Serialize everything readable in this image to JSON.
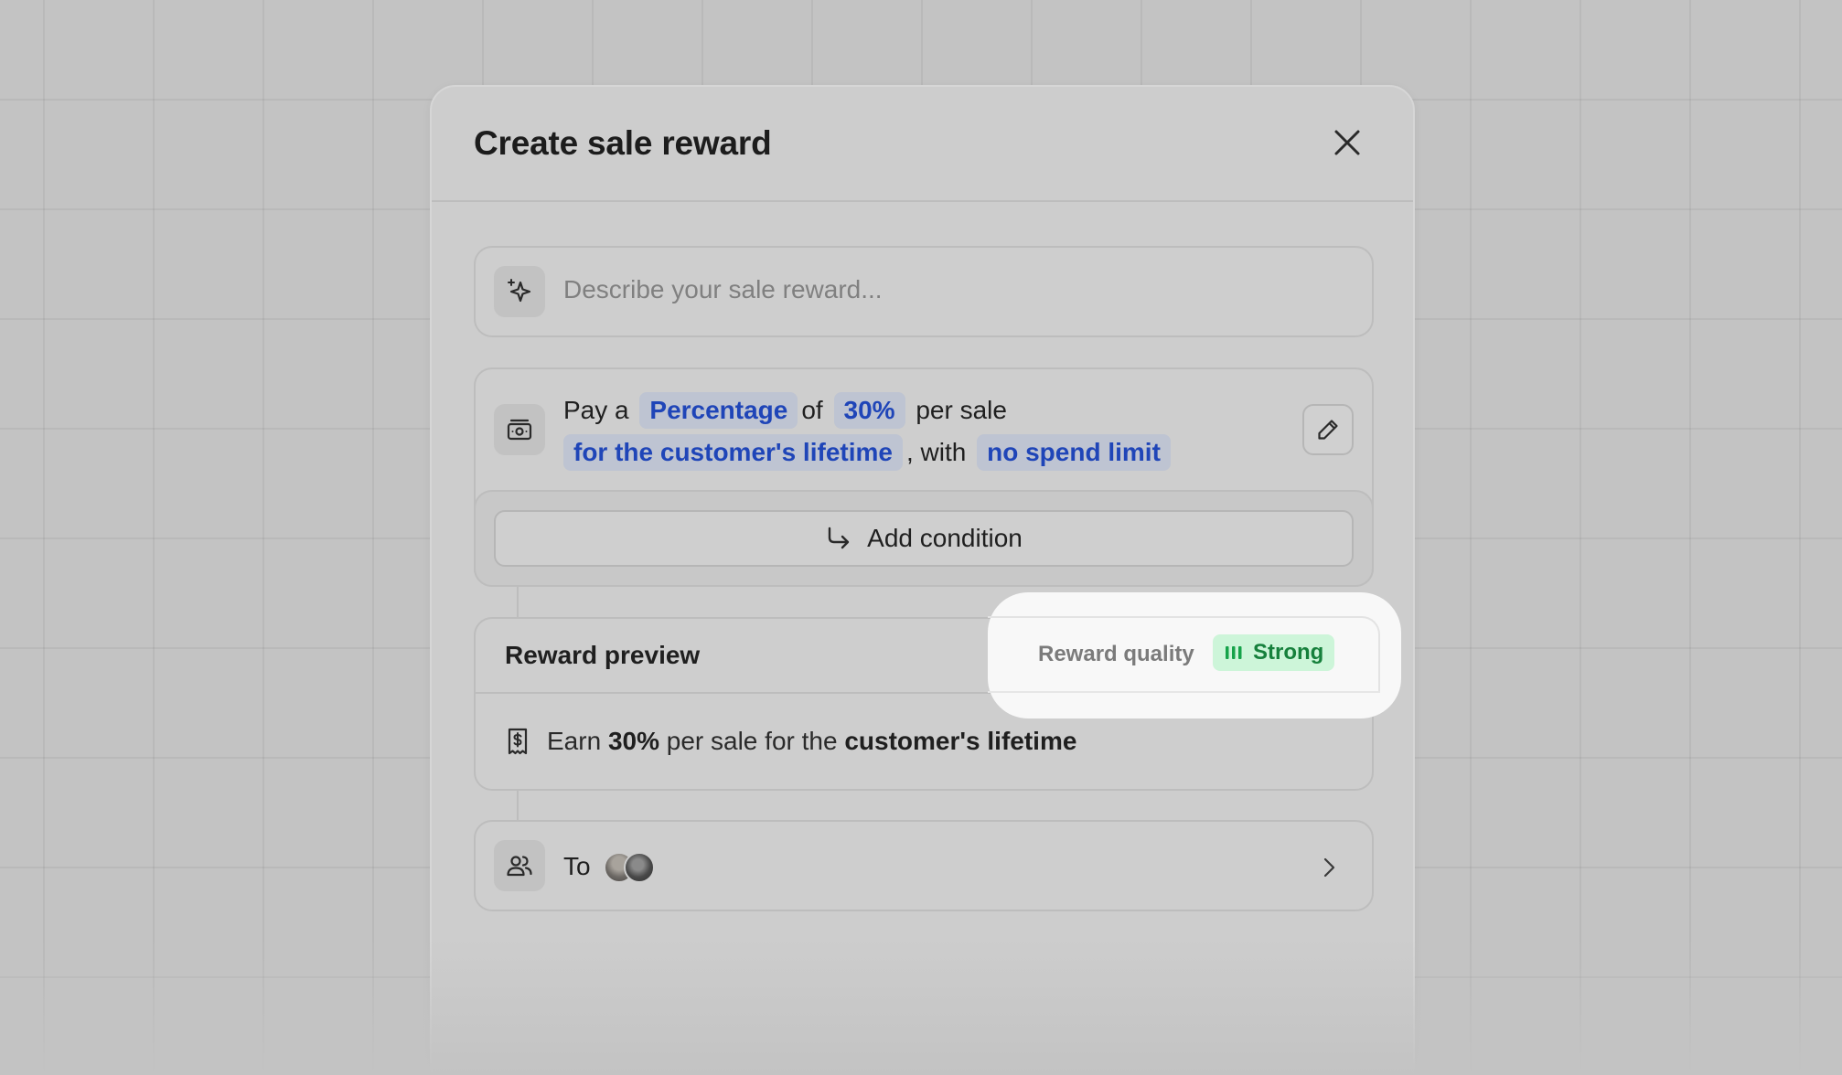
{
  "modal": {
    "title": "Create sale reward",
    "close_icon": "close-icon"
  },
  "describe": {
    "icon": "sparkle-icon",
    "placeholder": "Describe your sale reward..."
  },
  "reward": {
    "icon": "money-icon",
    "pay_a": "Pay a",
    "type": "Percentage",
    "of": "of",
    "amount": "30%",
    "per_sale": "per sale",
    "duration": "for the customer's lifetime",
    "with": ", with",
    "limit": "no spend limit",
    "edit_icon": "pencil-icon"
  },
  "condition": {
    "icon": "arrow-turn-icon",
    "label": "Add condition"
  },
  "preview": {
    "title": "Reward preview",
    "quality_label": "Reward quality",
    "quality_value": "Strong",
    "quality_color": "#16803c",
    "receipt_icon": "receipt-dollar-icon",
    "earn": "Earn",
    "amount": "30%",
    "per_sale_for_the": "per sale for the",
    "duration": "customer's lifetime"
  },
  "to": {
    "icon": "users-icon",
    "label": "To",
    "chevron_icon": "chevron-right-icon"
  },
  "colors": {
    "pill_text": "#1f45b8",
    "pill_bg": "#bec4d2",
    "badge_bg": "#cdf5d9"
  }
}
